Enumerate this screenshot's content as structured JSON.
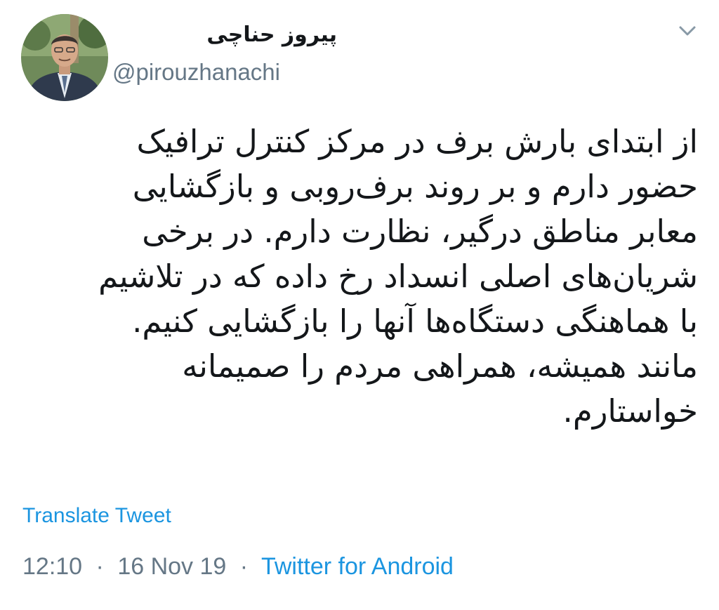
{
  "author": {
    "display_name": "پیروز حناچی",
    "handle": "@pirouzhanachi"
  },
  "icons": {
    "menu": "chevron-down-icon",
    "avatar": "profile-photo"
  },
  "tweet": {
    "text_lines": [
      "از ابتدای بارش برف در مرکز کنترل ترافیک",
      "حضور دارم و بر روند برف‌روبی و بازگشایی",
      "معابر مناطق درگیر، نظارت دارم. در برخی",
      "شریان‌های اصلی انسداد رخ داده که در تلاشیم",
      "با هماهنگی دستگاه‌ها آنها را بازگشایی کنیم.",
      "مانند همیشه، همراهی مردم را صمیمانه",
      "خواستارم."
    ],
    "translate_label": "Translate Tweet",
    "time": "12:10",
    "date": "16 Nov 19",
    "separator": "·",
    "source": "Twitter for Android"
  },
  "colors": {
    "link": "#1b95e0",
    "secondary": "#657786",
    "text": "#14171a"
  }
}
